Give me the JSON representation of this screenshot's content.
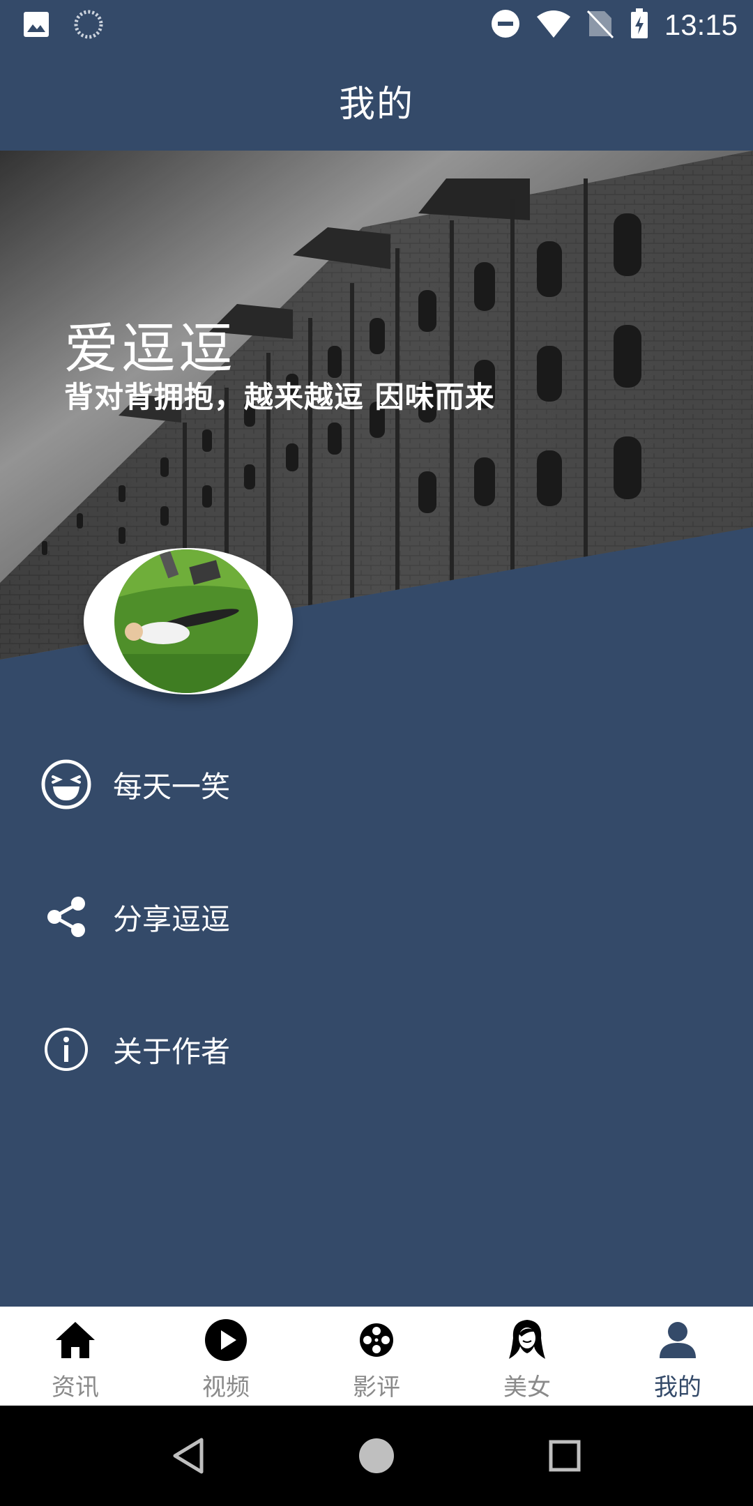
{
  "status_bar": {
    "time": "13:15",
    "left_icons": [
      "image-icon",
      "loading-icon"
    ],
    "right_icons": [
      "do-not-disturb-icon",
      "wifi-icon",
      "no-sim-icon",
      "battery-charging-icon"
    ]
  },
  "header": {
    "title": "我的"
  },
  "profile": {
    "name": "爱逗逗",
    "slogan": "背对背拥抱，越来越逗  因味而来"
  },
  "menu": [
    {
      "label": "每天一笑",
      "icon": "laughing-face-icon"
    },
    {
      "label": "分享逗逗",
      "icon": "share-icon"
    },
    {
      "label": "关于作者",
      "icon": "info-icon"
    }
  ],
  "tabs": [
    {
      "label": "资讯",
      "icon": "home-icon",
      "active": false
    },
    {
      "label": "视频",
      "icon": "play-icon",
      "active": false
    },
    {
      "label": "影评",
      "icon": "film-reel-icon",
      "active": false
    },
    {
      "label": "美女",
      "icon": "woman-icon",
      "active": false
    },
    {
      "label": "我的",
      "icon": "person-icon",
      "active": true
    }
  ],
  "colors": {
    "primary": "#344a69",
    "tab_inactive": "#8a8a8a",
    "tab_background": "#ffffff"
  }
}
